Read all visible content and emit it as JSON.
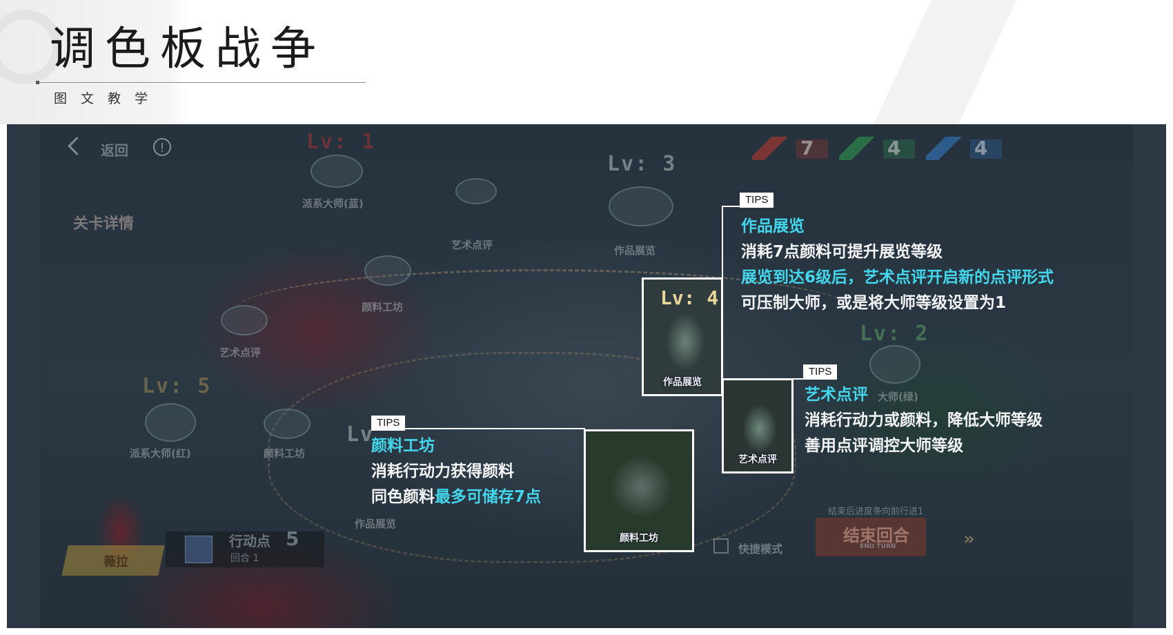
{
  "header": {
    "title": "调色板战争",
    "subtitle": "图文教学"
  },
  "game": {
    "top_bar": {
      "back_label": "返回",
      "info_glyph": "!",
      "paints": [
        {
          "value": "7",
          "color": "#c0392b",
          "icon": "red-paint-tube-icon"
        },
        {
          "value": "4",
          "color": "#2e9e4f",
          "icon": "green-paint-tube-icon"
        },
        {
          "value": "4",
          "color": "#2f7fd0",
          "icon": "blue-paint-tube-icon"
        }
      ]
    },
    "stage_detail": "关卡详情",
    "map": {
      "nodes": [
        {
          "lv": "Lv: 1",
          "label": "派系大师(蓝)",
          "lv_color": "#8a2f34"
        },
        {
          "lv": "Lv: 3",
          "label": "作品展览",
          "lv_color": "#8f9aa0"
        },
        {
          "lv": "Lv: 5",
          "label": "派系大师(红)",
          "lv_color": "#7a6a40"
        },
        {
          "lv": "Lv: 2",
          "label": "大师(绿)",
          "lv_color": "#4c7b54"
        },
        {
          "lv": "Lv",
          "label": "",
          "lv_color": "#8f9aa0"
        }
      ],
      "labels": [
        "艺术点评",
        "颜料工坊",
        "艺术点评",
        "颜料工坊",
        "作品展览"
      ]
    },
    "hud": {
      "character_name": "薇拉",
      "action_points_label": "行动点",
      "action_points_value": "5",
      "round_label": "回合 1",
      "quick_mode_label": "快捷模式",
      "end_turn_hint": "结束后进度条向前行进1",
      "end_turn_label": "结束回合",
      "end_turn_sub": "END TURN",
      "next_glyph": "»"
    }
  },
  "callouts": {
    "exhibition": {
      "tag": "TIPS",
      "title": "作品展览",
      "line1": "消耗7点颜料可提升展览等级",
      "line2": "展览到达6级后，艺术点评开启新的点评形式",
      "line3": "可压制大师，或是将大师等级设置为1",
      "thumb_lv": "Lv: 4",
      "thumb_caption": "作品展览"
    },
    "critique": {
      "tag": "TIPS",
      "title": "艺术点评",
      "line1": "消耗行动力或颜料，降低大师等级",
      "line2": "善用点评调控大师等级",
      "thumb_caption": "艺术点评"
    },
    "workshop": {
      "tag": "TIPS",
      "title": "颜料工坊",
      "line1": "消耗行动力获得颜料",
      "line2_white": "同色颜料",
      "line2_cyan": "最多可储存7点",
      "thumb_caption": "颜料工坊"
    }
  }
}
